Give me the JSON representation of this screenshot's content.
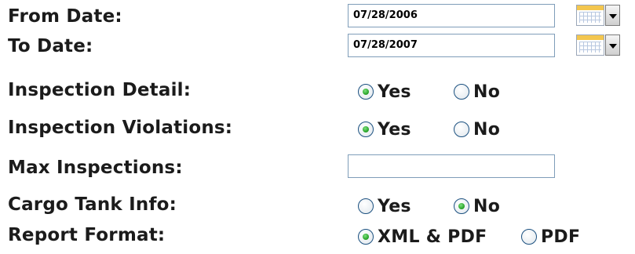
{
  "form": {
    "from_date": {
      "label": "From Date:",
      "value": "07/28/2006"
    },
    "to_date": {
      "label": "To Date:",
      "value": "07/28/2007"
    },
    "inspection_detail": {
      "label": "Inspection Detail:",
      "options": [
        {
          "label": "Yes",
          "checked": true
        },
        {
          "label": "No",
          "checked": false
        }
      ]
    },
    "inspection_violations": {
      "label": "Inspection Violations:",
      "options": [
        {
          "label": "Yes",
          "checked": true
        },
        {
          "label": "No",
          "checked": false
        }
      ]
    },
    "max_inspections": {
      "label": "Max Inspections:",
      "value": ""
    },
    "cargo_tank_info": {
      "label": "Cargo Tank Info:",
      "options": [
        {
          "label": "Yes",
          "checked": false
        },
        {
          "label": "No",
          "checked": true
        }
      ]
    },
    "report_format": {
      "label": "Report Format:",
      "options": [
        {
          "label": "XML & PDF",
          "checked": true
        },
        {
          "label": "PDF",
          "checked": false
        }
      ]
    }
  }
}
